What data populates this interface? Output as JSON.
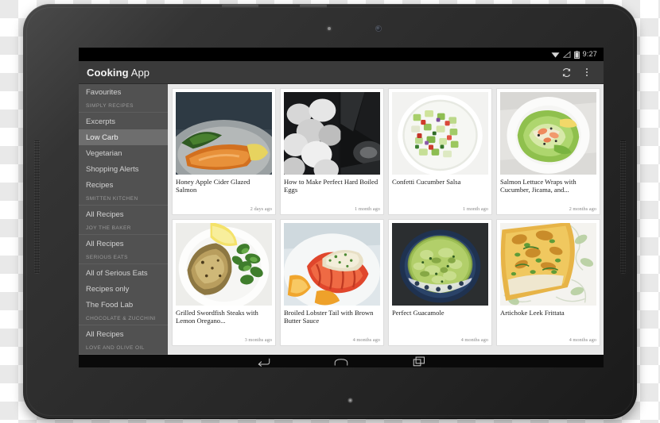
{
  "device": {
    "type": "android-tablet",
    "orientation": "landscape"
  },
  "status_bar": {
    "clock": "9:27",
    "icons": [
      "wifi-icon",
      "signal-icon",
      "battery-icon"
    ]
  },
  "action_bar": {
    "title_bold": "Cooking",
    "title_light": "App",
    "refresh_label": "Refresh",
    "overflow_label": "More options"
  },
  "sidebar": {
    "items": [
      {
        "type": "item",
        "label": "Favourites",
        "selected": false
      },
      {
        "type": "section",
        "label": "SIMPLY RECIPES"
      },
      {
        "type": "item",
        "label": "Excerpts",
        "selected": false
      },
      {
        "type": "item",
        "label": "Low Carb",
        "selected": true
      },
      {
        "type": "item",
        "label": "Vegetarian",
        "selected": false
      },
      {
        "type": "item",
        "label": "Shopping Alerts",
        "selected": false
      },
      {
        "type": "item",
        "label": "Recipes",
        "selected": false
      },
      {
        "type": "section",
        "label": "SMITTEN KITCHEN"
      },
      {
        "type": "item",
        "label": "All Recipes",
        "selected": false
      },
      {
        "type": "section",
        "label": "JOY THE BAKER"
      },
      {
        "type": "item",
        "label": "All Recipes",
        "selected": false
      },
      {
        "type": "section",
        "label": "SERIOUS EATS"
      },
      {
        "type": "item",
        "label": "All of Serious Eats",
        "selected": false
      },
      {
        "type": "item",
        "label": "Recipes only",
        "selected": false
      },
      {
        "type": "item",
        "label": "The Food Lab",
        "selected": false
      },
      {
        "type": "section",
        "label": "CHOCOLATE & ZUCCHINI"
      },
      {
        "type": "item",
        "label": "All Recipes",
        "selected": false
      },
      {
        "type": "section",
        "label": "LOVE AND OLIVE OIL"
      }
    ]
  },
  "content": {
    "cards": [
      {
        "title": "Honey Apple Cider Glazed Salmon",
        "date": "2 days ago",
        "thumb": "salmon-spinach-plate"
      },
      {
        "title": "How to Make Perfect Hard Boiled Eggs",
        "date": "1 month ago",
        "thumb": "boiled-eggs-bw"
      },
      {
        "title": "Confetti Cucumber Salsa",
        "date": "1 month ago",
        "thumb": "cucumber-salsa-bowl"
      },
      {
        "title": "Salmon Lettuce Wraps with Cucumber, Jicama, and...",
        "date": "2 months ago",
        "thumb": "lettuce-wrap-plate"
      },
      {
        "title": "Grilled Swordfish Steaks with Lemon Oregano...",
        "date": "3 months ago",
        "thumb": "swordfish-lemon-plate"
      },
      {
        "title": "Broiled Lobster Tail with Brown Butter Sauce",
        "date": "4 months ago",
        "thumb": "lobster-tail-plate"
      },
      {
        "title": "Perfect Guacamole",
        "date": "4 months ago",
        "thumb": "guacamole-bowl"
      },
      {
        "title": "Artichoke Leek Frittata",
        "date": "4 months ago",
        "thumb": "frittata-slice"
      }
    ]
  },
  "nav_bar": {
    "back_label": "Back",
    "home_label": "Home",
    "recents_label": "Recent apps"
  },
  "colors": {
    "action_bar": "#3a3a3a",
    "sidebar": "#515151",
    "sidebar_selected": "#6e6e6e",
    "content_bg": "#e8e8e8",
    "card_bg": "#ffffff"
  }
}
